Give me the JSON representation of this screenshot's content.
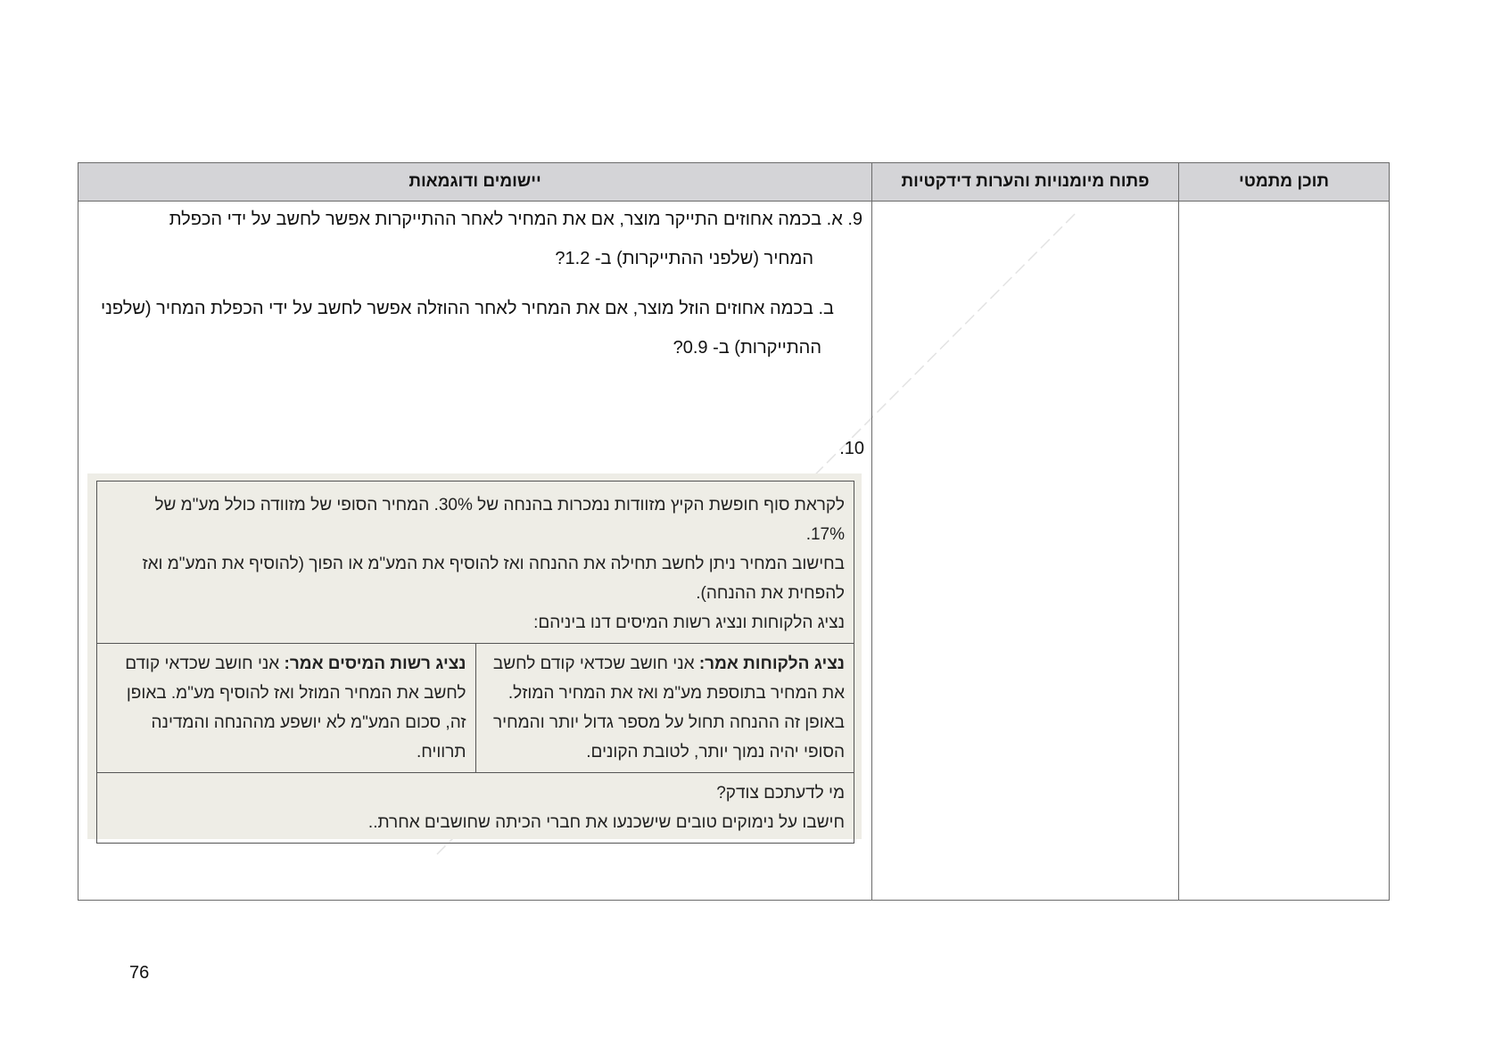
{
  "table": {
    "headers": {
      "content": "תוכן מתמטי",
      "didactic": "פתוח מיומנויות והערות דידקטיות",
      "examples": "יישומים ודוגמאות"
    }
  },
  "questions": {
    "q9a_line1": "9. א. בכמה אחוזים התייקר מוצר, אם את המחיר לאחר ההתייקרות אפשר לחשב על ידי הכפלת",
    "q9a_line2": "המחיר (שלפני ההתייקרות) ב- 1.2?",
    "q9b_line1": "ב. בכמה אחוזים הוזל מוצר, אם את המחיר לאחר ההוזלה אפשר לחשב על ידי הכפלת המחיר     (שלפני",
    "q9b_line2": "ההתייקרות) ב- 0.9?",
    "q10_label": "10."
  },
  "box": {
    "intro_line1": "לקראת סוף חופשת הקיץ מזוודות נמכרות בהנחה של 30%. המחיר הסופי של מזוודה כולל מע\"מ של",
    "intro_line2": "17%.",
    "intro_line3": "בחישוב המחיר ניתן לחשב תחילה את ההנחה ואז להוסיף את המע\"מ או הפוך (להוסיף את המע\"מ ואז",
    "intro_line4": "להפחית את ההנחה).",
    "intro_line5": "נציג הלקוחות ונציג רשות המיסים דנו ביניהם:",
    "customers_speaker": "נציג הלקוחות אמר:",
    "customers_text": " אני חושב שכדאי קודם לחשב את המחיר בתוספת מע\"מ ואז את המחיר המוזל. באופן זה ההנחה תחול על מספר גדול יותר והמחיר הסופי יהיה נמוך יותר, לטובת הקונים.",
    "tax_speaker": "נציג רשות המיסים אמר:",
    "tax_text": " אני חושב שכדאי קודם לחשב את המחיר המוזל ואז להוסיף מע\"מ. באופן זה, סכום המע\"מ לא יושפע מההנחה והמדינה תרוויח.",
    "question_line1": "מי לדעתכם צודק?",
    "question_line2": "חישבו על נימוקים טובים שישכנעו את חברי הכיתה שחושבים אחרת.."
  },
  "page_number": "76"
}
